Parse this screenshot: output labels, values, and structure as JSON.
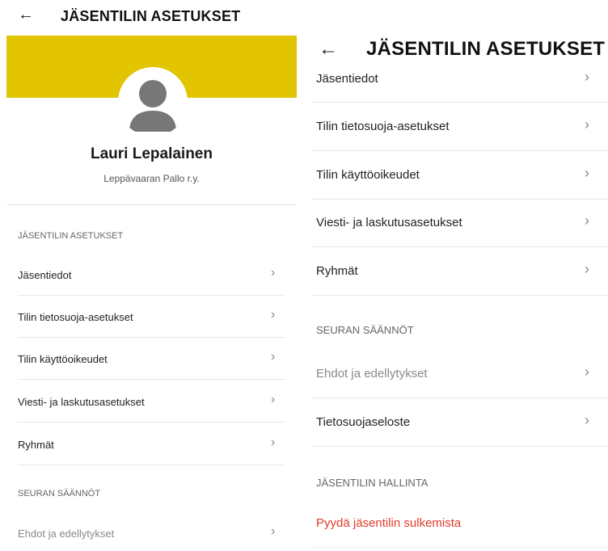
{
  "left": {
    "header": {
      "back_icon": "arrow-left-icon",
      "title": "JÄSENTILIN ASETUKSET"
    },
    "profile": {
      "name": "Lauri Lepalainen",
      "organization": "Leppävaaran Pallo r.y.",
      "banner_color": "#e2c400",
      "avatar_icon": "user-avatar-icon"
    },
    "sections": [
      {
        "label": "JÄSENTILIN ASETUKSET",
        "items": [
          {
            "label": "Jäsentiedot"
          },
          {
            "label": "Tilin tietosuoja-asetukset"
          },
          {
            "label": "Tilin käyttöoikeudet"
          },
          {
            "label": "Viesti- ja laskutusasetukset"
          },
          {
            "label": "Ryhmät"
          }
        ]
      },
      {
        "label": "SEURAN SÄÄNNÖT",
        "items": [
          {
            "label": "Ehdot ja edellytykset"
          }
        ]
      }
    ]
  },
  "right": {
    "header": {
      "back_icon": "arrow-left-icon",
      "title": "JÄSENTILIN ASETUKSET"
    },
    "items_top": [
      {
        "label": "Jäsentiedot"
      },
      {
        "label": "Tilin tietosuoja-asetukset"
      },
      {
        "label": "Tilin käyttöoikeudet"
      },
      {
        "label": "Viesti- ja laskutusasetukset"
      },
      {
        "label": "Ryhmät"
      }
    ],
    "rules_section": {
      "label": "SEURAN SÄÄNNÖT",
      "items": [
        {
          "label": "Ehdot ja edellytykset"
        },
        {
          "label": "Tietosuojaseloste"
        }
      ]
    },
    "management_section": {
      "label": "JÄSENTILIN HALLINTA",
      "items": [
        {
          "label": "Pyydä jäsentilin sulkemista"
        }
      ]
    }
  },
  "chevron_glyph": "›",
  "back_glyph": "←",
  "colors": {
    "accent_yellow": "#e2c400",
    "danger": "#e03b2b",
    "muted_text": "#8a8a8a"
  }
}
